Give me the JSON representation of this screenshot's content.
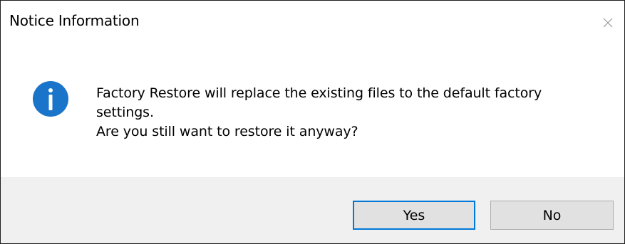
{
  "window": {
    "title": "Notice Information",
    "close_icon": "close-icon"
  },
  "content": {
    "icon": "info-icon",
    "icon_color": "#1a74c9",
    "message_lines": [
      "Factory Restore will replace the existing files to the default factory",
      "settings.",
      "Are you still want to restore it anyway?"
    ]
  },
  "buttons": {
    "yes_label": "Yes",
    "no_label": "No",
    "default_button": "Yes",
    "focus_color": "#0078d7"
  }
}
